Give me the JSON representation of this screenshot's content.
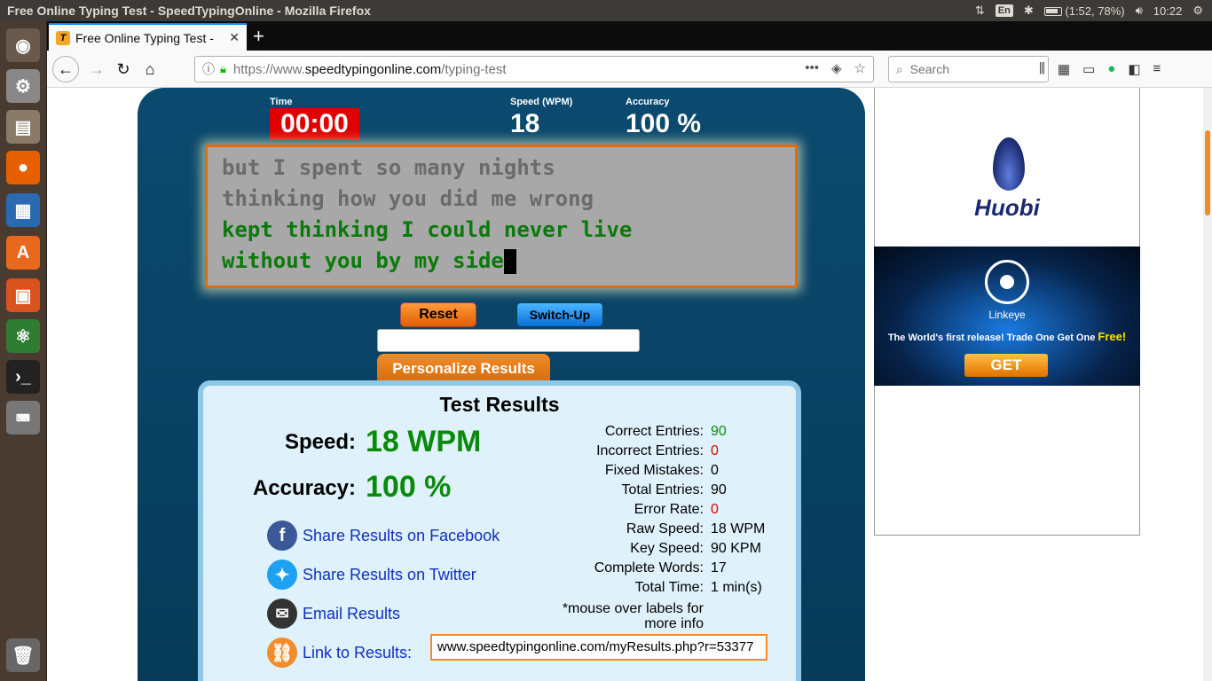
{
  "os": {
    "window_title": "Free Online Typing Test - SpeedTypingOnline - Mozilla Firefox",
    "keyboard_layout": "En",
    "battery": "(1:52, 78%)",
    "clock": "10:22"
  },
  "browser": {
    "tab_title": "Free Online Typing Test -",
    "url_prefix": "https://www.",
    "url_domain": "speedtypingonline.com",
    "url_path": "/typing-test",
    "search_placeholder": "Search"
  },
  "stats": {
    "time_label": "Time",
    "time_value": "00:00",
    "speed_label": "Speed (WPM)",
    "speed_value": "18",
    "accuracy_label": "Accuracy",
    "accuracy_value": "100 %"
  },
  "typing_text": {
    "line1": "but I spent so many nights",
    "line2": "thinking how you did me wrong",
    "line3": "kept thinking I could never live",
    "line4": "without you by my side"
  },
  "controls": {
    "reset_label": "Reset",
    "switch_label": "Switch-Up",
    "personalize_label": "Personalize Results"
  },
  "results": {
    "title": "Test Results",
    "speed_label": "Speed:",
    "speed_value": "18 WPM",
    "accuracy_label": "Accuracy:",
    "accuracy_value": "100 %",
    "share": [
      {
        "label": "Share Results on Facebook"
      },
      {
        "label": "Share Results on Twitter"
      },
      {
        "label": "Email Results"
      },
      {
        "label": "Link to Results:"
      }
    ],
    "details": [
      {
        "label": "Correct Entries:",
        "value": "90"
      },
      {
        "label": "Incorrect Entries:",
        "value": "0"
      },
      {
        "label": "Fixed Mistakes:",
        "value": "0"
      },
      {
        "label": "Total Entries:",
        "value": "90"
      },
      {
        "label": "Error Rate:",
        "value": "0"
      },
      {
        "label": "Raw Speed:",
        "value": "18 WPM"
      },
      {
        "label": "Key Speed:",
        "value": "90 KPM"
      },
      {
        "label": "Complete Words:",
        "value": "17"
      },
      {
        "label": "Total Time:",
        "value": "1 min(s)"
      }
    ],
    "note": "*mouse over labels for more info",
    "link_value": "www.speedtypingonline.com/myResults.php?r=53377"
  },
  "ads": {
    "huobi_name": "Huobi",
    "linkeye_brand": "Linkeye",
    "linkeye_tagline": "The World's first release!  Trade One Get One",
    "linkeye_free": "Free!",
    "linkeye_cta": "GET"
  }
}
